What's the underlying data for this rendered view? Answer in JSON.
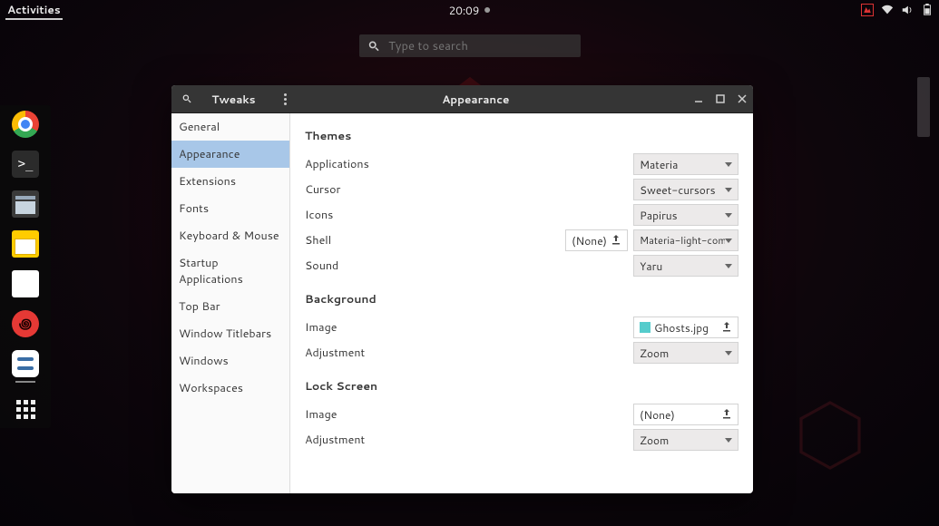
{
  "topbar": {
    "activities": "Activities",
    "time": "20:09"
  },
  "search": {
    "placeholder": "Type to search"
  },
  "window": {
    "app_name": "Tweaks",
    "page_title": "Appearance"
  },
  "sidebar": {
    "items": [
      "General",
      "Appearance",
      "Extensions",
      "Fonts",
      "Keyboard & Mouse",
      "Startup Applications",
      "Top Bar",
      "Window Titlebars",
      "Windows",
      "Workspaces"
    ]
  },
  "content": {
    "themes_header": "Themes",
    "applications_label": "Applications",
    "applications_value": "Materia",
    "cursor_label": "Cursor",
    "cursor_value": "Sweet-cursors",
    "icons_label": "Icons",
    "icons_value": "Papirus",
    "shell_label": "Shell",
    "shell_none": "(None)",
    "shell_value": "Materia-light-compact",
    "sound_label": "Sound",
    "sound_value": "Yaru",
    "background_header": "Background",
    "bg_image_label": "Image",
    "bg_image_value": "Ghosts.jpg",
    "bg_adjust_label": "Adjustment",
    "bg_adjust_value": "Zoom",
    "lock_header": "Lock Screen",
    "lock_image_label": "Image",
    "lock_image_value": "(None)",
    "lock_adjust_label": "Adjustment",
    "lock_adjust_value": "Zoom"
  }
}
